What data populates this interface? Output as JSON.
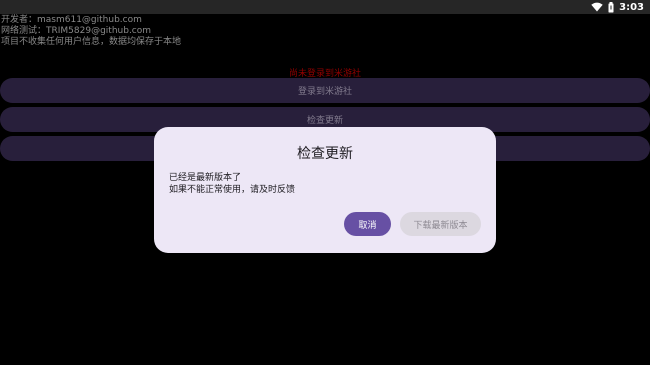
{
  "status_bar": {
    "time": "3:03",
    "icons": [
      "wifi-icon",
      "battery-icon"
    ]
  },
  "info": {
    "developer": "开发者：masm611@github.com",
    "network_test": "网络测试：TRIM5829@github.com",
    "privacy": "项目不收集任何用户信息，数据均保存于本地"
  },
  "warning": "尚未登录到米游社",
  "buttons": {
    "login": "登录到米游社",
    "check_update": "检查更新"
  },
  "dialog": {
    "title": "检查更新",
    "message_line1": "已经是最新版本了",
    "message_line2": "如果不能正常使用，请及时反馈",
    "cancel": "取消",
    "download": "下载最新版本"
  },
  "colors": {
    "accent": "#6750a4",
    "warning": "#d40000",
    "button_bg": "#3c2f57",
    "dialog_bg": "#ede7f6"
  }
}
